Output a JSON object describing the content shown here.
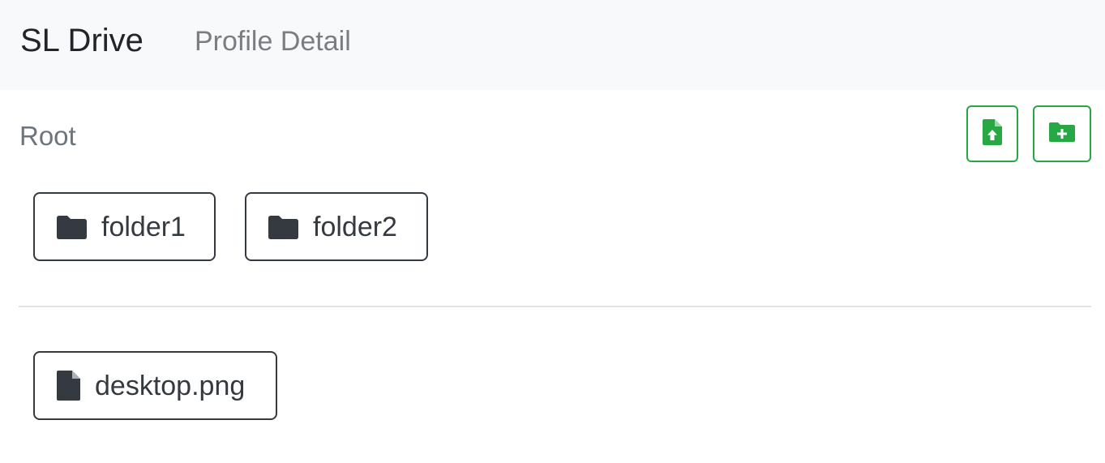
{
  "navbar": {
    "brand": "SL Drive",
    "link": "Profile Detail"
  },
  "breadcrumb": {
    "current": "Root"
  },
  "actions": {
    "upload_icon": "file-upload-icon",
    "add_folder_icon": "folder-plus-icon",
    "accent_color": "#28a745"
  },
  "folders": [
    {
      "name": "folder1",
      "icon": "folder-icon"
    },
    {
      "name": "folder2",
      "icon": "folder-icon"
    }
  ],
  "files": [
    {
      "name": "desktop.png",
      "icon": "file-icon"
    }
  ]
}
